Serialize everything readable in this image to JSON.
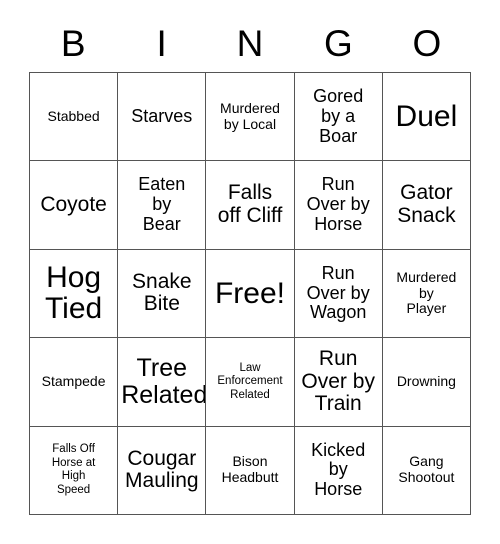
{
  "card": {
    "header_letters": [
      "B",
      "I",
      "N",
      "G",
      "O"
    ],
    "columns": 5,
    "rows": 5,
    "colors": {
      "background": "#ffffff",
      "cell_background": "#ffffff",
      "border": "#555555",
      "text": "#000000"
    },
    "cells": [
      {
        "text": "Stabbed",
        "size": "sm"
      },
      {
        "text": "Starves",
        "size": "md"
      },
      {
        "text": "Murdered\nby Local",
        "size": "sm"
      },
      {
        "text": "Gored\nby a\nBoar",
        "size": "md"
      },
      {
        "text": "Duel",
        "size": "xxl"
      },
      {
        "text": "Coyote",
        "size": "lg"
      },
      {
        "text": "Eaten\nby\nBear",
        "size": "md"
      },
      {
        "text": "Falls\noff Cliff",
        "size": "lg"
      },
      {
        "text": "Run\nOver by\nHorse",
        "size": "md"
      },
      {
        "text": "Gator\nSnack",
        "size": "lg"
      },
      {
        "text": "Hog\nTied",
        "size": "xxl"
      },
      {
        "text": "Snake\nBite",
        "size": "lg"
      },
      {
        "text": "Free!",
        "size": "xxl"
      },
      {
        "text": "Run\nOver by\nWagon",
        "size": "md"
      },
      {
        "text": "Murdered\nby\nPlayer",
        "size": "sm"
      },
      {
        "text": "Stampede",
        "size": "sm"
      },
      {
        "text": "Tree\nRelated",
        "size": "xl"
      },
      {
        "text": "Law\nEnforcement\nRelated",
        "size": "xs"
      },
      {
        "text": "Run\nOver by\nTrain",
        "size": "lg"
      },
      {
        "text": "Drowning",
        "size": "sm"
      },
      {
        "text": "Falls Off\nHorse at\nHigh\nSpeed",
        "size": "xs"
      },
      {
        "text": "Cougar\nMauling",
        "size": "lg"
      },
      {
        "text": "Bison\nHeadbutt",
        "size": "sm"
      },
      {
        "text": "Kicked\nby\nHorse",
        "size": "md"
      },
      {
        "text": "Gang\nShootout",
        "size": "sm"
      }
    ]
  }
}
